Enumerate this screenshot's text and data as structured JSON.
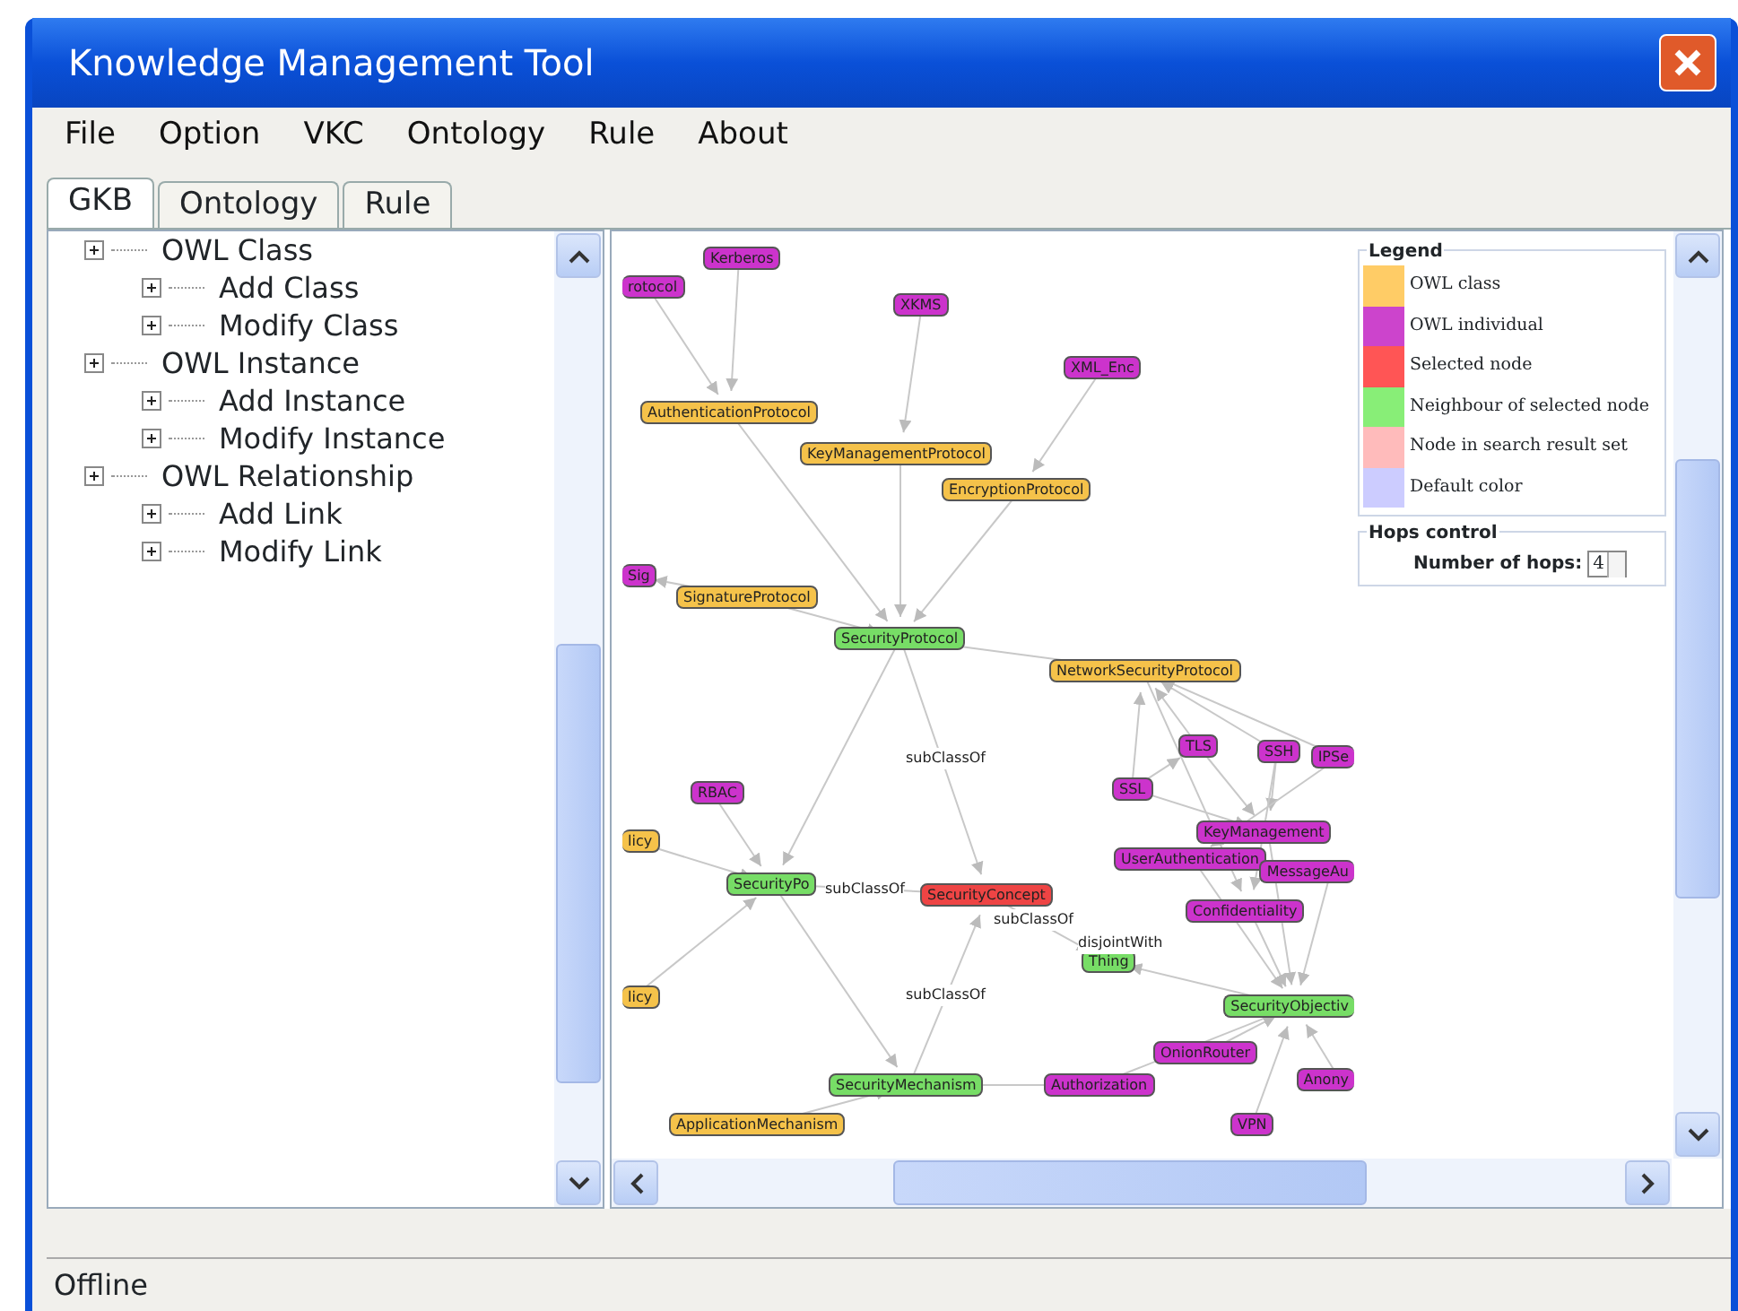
{
  "window": {
    "title": "Knowledge Management Tool"
  },
  "menu": [
    "File",
    "Option",
    "VKC",
    "Ontology",
    "Rule",
    "About"
  ],
  "tabs": [
    {
      "label": "GKB",
      "selected": true
    },
    {
      "label": "Ontology",
      "selected": false
    },
    {
      "label": "Rule",
      "selected": false
    }
  ],
  "tree": [
    {
      "label": "OWL Class",
      "children": [
        {
          "label": "Add Class"
        },
        {
          "label": "Modify Class"
        }
      ]
    },
    {
      "label": "OWL Instance",
      "children": [
        {
          "label": "Add Instance"
        },
        {
          "label": "Modify Instance"
        }
      ]
    },
    {
      "label": "OWL Relationship",
      "children": [
        {
          "label": "Add Link"
        },
        {
          "label": "Modify Link"
        }
      ]
    }
  ],
  "graph": {
    "nodes": [
      {
        "label": "rotocol",
        "kind": "individual"
      },
      {
        "label": "Kerberos",
        "kind": "individual"
      },
      {
        "label": "XKMS",
        "kind": "individual"
      },
      {
        "label": "XML_Enc",
        "kind": "individual"
      },
      {
        "label": "AuthenticationProtocol",
        "kind": "class"
      },
      {
        "label": "KeyManagementProtocol",
        "kind": "class"
      },
      {
        "label": "EncryptionProtocol",
        "kind": "class"
      },
      {
        "label": "Sig",
        "kind": "individual"
      },
      {
        "label": "SignatureProtocol",
        "kind": "class"
      },
      {
        "label": "SecurityProtocol",
        "kind": "neighbour"
      },
      {
        "label": "NetworkSecurityProtocol",
        "kind": "class"
      },
      {
        "label": "TLS",
        "kind": "individual"
      },
      {
        "label": "SSH",
        "kind": "individual"
      },
      {
        "label": "IPSe",
        "kind": "individual"
      },
      {
        "label": "SSL",
        "kind": "individual"
      },
      {
        "label": "RBAC",
        "kind": "individual"
      },
      {
        "label": "licy",
        "kind": "class"
      },
      {
        "label": "KeyManagement",
        "kind": "individual"
      },
      {
        "label": "UserAuthentication",
        "kind": "individual"
      },
      {
        "label": "MessageAu",
        "kind": "individual"
      },
      {
        "label": "SecurityPo",
        "kind": "neighbour"
      },
      {
        "label": "SecurityConcept",
        "kind": "selected"
      },
      {
        "label": "Confidentiality",
        "kind": "individual"
      },
      {
        "label": "Thing",
        "kind": "neighbour"
      },
      {
        "label": "licy",
        "kind": "class"
      },
      {
        "label": "SecurityObjectiv",
        "kind": "neighbour"
      },
      {
        "label": "OnionRouter",
        "kind": "individual"
      },
      {
        "label": "SecurityMechanism",
        "kind": "neighbour"
      },
      {
        "label": "Authorization",
        "kind": "individual"
      },
      {
        "label": "Anony",
        "kind": "individual"
      },
      {
        "label": "ApplicationMechanism",
        "kind": "class"
      },
      {
        "label": "VPN",
        "kind": "individual"
      }
    ],
    "edge_labels": [
      "subClassOf",
      "subClassOf",
      "subClassOf",
      "disjointWith",
      "subClassOf"
    ]
  },
  "legend": {
    "title": "Legend",
    "items": [
      {
        "label": "OWL class",
        "color": "#ffcc66"
      },
      {
        "label": "OWL individual",
        "color": "#cc44cc"
      },
      {
        "label": "Selected node",
        "color": "#ff5555"
      },
      {
        "label": "Neighbour of selected node",
        "color": "#88ee77"
      },
      {
        "label": "Node in search result set",
        "color": "#ffbbbb"
      },
      {
        "label": "Default color",
        "color": "#ccccff"
      }
    ]
  },
  "hops": {
    "title": "Hops control",
    "label": "Number of hops:",
    "value": "4"
  },
  "status_bar": "Offline"
}
